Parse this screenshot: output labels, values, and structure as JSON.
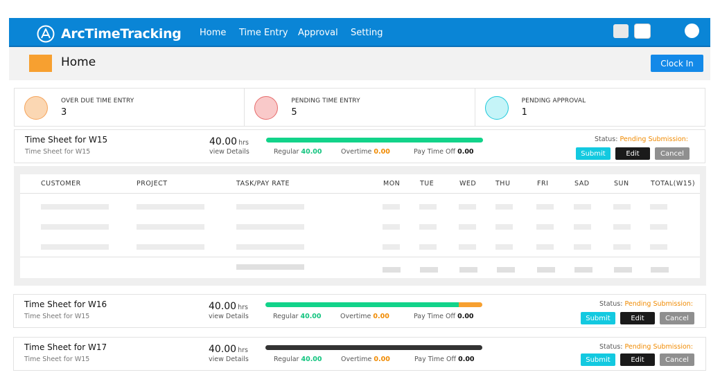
{
  "app": {
    "brand": "ArcTimeTracking",
    "nav": [
      "Home",
      "Time Entry",
      "Approval",
      "Setting"
    ],
    "accent": "#0a85d6"
  },
  "page": {
    "title": "Home",
    "clock_in": "Clock In"
  },
  "stats": [
    {
      "label": "OVER DUE TIME ENTRY",
      "value": "3",
      "color": "#fbd7b3",
      "border": "#f5a35a"
    },
    {
      "label": "PENDING TIME ENTRY",
      "value": "5",
      "color": "#f9c9c9",
      "border": "#e66a6a"
    },
    {
      "label": "PENDING APPROVAL",
      "value": "1",
      "color": "#c5f4f8",
      "border": "#1cc8da"
    }
  ],
  "timesheets": [
    {
      "title": "Time Sheet for W15",
      "subtitle": "Time Sheet for W15",
      "hours": "40.00",
      "hrs_unit": "hrs",
      "view": "view Details",
      "regular_label": "Regular",
      "regular": "40.00",
      "overtime_label": "Overtime",
      "overtime": "0.00",
      "pto_label": "Pay Time Off",
      "pto": "0.00",
      "status_label": "Status:",
      "status": "Pending Submission:",
      "submit": "Submit",
      "edit": "Edit",
      "cancel": "Cancel",
      "progress_regular": 1.0,
      "progress_overtime": 0.0,
      "bar_color": "#12d38a"
    },
    {
      "title": "Time Sheet for W16",
      "subtitle": "Time Sheet for W15",
      "hours": "40.00",
      "hrs_unit": "hrs",
      "view": "view Details",
      "regular_label": "Regular",
      "regular": "40.00",
      "overtime_label": "Overtime",
      "overtime": "0.00",
      "pto_label": "Pay Time Off",
      "pto": "0.00",
      "status_label": "Status:",
      "status": "Pending Submission:",
      "submit": "Submit",
      "edit": "Edit",
      "cancel": "Cancel",
      "progress_regular": 0.89,
      "progress_overtime": 0.11,
      "bar_color": "#12d38a"
    },
    {
      "title": "Time Sheet for W17",
      "subtitle": "Time Sheet for W15",
      "hours": "40.00",
      "hrs_unit": "hrs",
      "view": "view Details",
      "regular_label": "Regular",
      "regular": "40.00",
      "overtime_label": "Overtime",
      "overtime": "0.00",
      "pto_label": "Pay Time Off",
      "pto": "0.00",
      "status_label": "Status:",
      "status": "Pending Submission:",
      "submit": "Submit",
      "edit": "Edit",
      "cancel": "Cancel",
      "progress_regular": 1.0,
      "progress_overtime": 0.0,
      "bar_color": "#333333"
    }
  ],
  "table": {
    "columns": [
      "CUSTOMER",
      "PROJECT",
      "TASK/PAY RATE",
      "MON",
      "TUE",
      "WED",
      "THU",
      "FRI",
      "SAD",
      "SUN",
      "TOTAL(W15)"
    ]
  }
}
